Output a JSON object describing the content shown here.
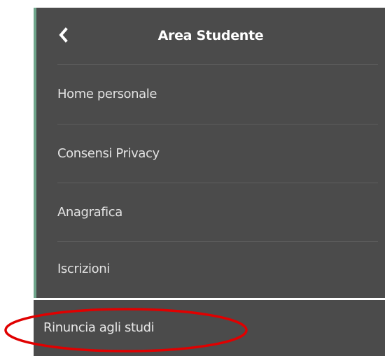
{
  "menu": {
    "title": "Area Studente",
    "back_icon": "chevron-left-icon",
    "items": [
      {
        "label": "Home personale"
      },
      {
        "label": "Consensi Privacy"
      },
      {
        "label": "Anagrafica"
      },
      {
        "label": "Iscrizioni"
      }
    ],
    "highlighted_item": {
      "label": "Rinuncia agli studi"
    }
  },
  "colors": {
    "panel_background": "#4b4b4b",
    "accent_stripe": "#6fa58b",
    "annotation_circle": "#e00000"
  }
}
